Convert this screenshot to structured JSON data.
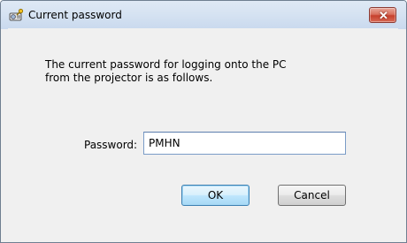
{
  "window": {
    "title": "Current password",
    "close_label": "✕"
  },
  "dialog": {
    "message": "The current password for logging onto the PC\nfrom the projector is as follows.",
    "password_label": "Password:",
    "password_value": "PMHN",
    "ok_label": "OK",
    "cancel_label": "Cancel"
  },
  "colors": {
    "titlebar": "#d6e3f2",
    "client_bg": "#f0f0f0",
    "close_button": "#c6402d",
    "default_button_border": "#3c7fb1"
  },
  "icons": {
    "title": "projector-key-icon",
    "close": "close-icon"
  }
}
